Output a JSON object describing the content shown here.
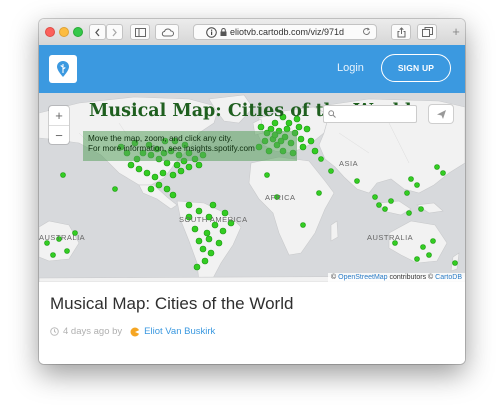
{
  "browser": {
    "url": "eliotvb.cartodb.com/viz/971d",
    "new_tab_label": "+"
  },
  "header": {
    "login_label": "Login",
    "signup_label": "SIGN UP"
  },
  "map": {
    "overlay_title": "Musical Map: Cities of the World",
    "overlay_description_line1": "Move the map, zoom, and click any city.",
    "overlay_description_line2": "For more information, see insights.spotify.com",
    "zoom_in_label": "+",
    "zoom_out_label": "−",
    "region_labels": {
      "asia": "ASIA",
      "africa": "AFRICA",
      "south_america": "SOUTH AMERICA",
      "australia_left": "AUSTRALIA",
      "australia_right": "AUSTRALIA"
    },
    "attribution": {
      "prefix": "©",
      "osm": "OpenStreetMap",
      "middle": "contributors ©",
      "carto": "CartoDB"
    },
    "colors": {
      "water": "#d7d9dc",
      "land": "#f2f2f2",
      "city_dot": "#33cc22"
    }
  },
  "page": {
    "title": "Musical Map: Cities of the World",
    "time_ago": "4 days ago by",
    "author": "Eliot Van Buskirk"
  },
  "colors": {
    "header_bg": "#3b99e0",
    "accent": "#3b99e0"
  }
}
